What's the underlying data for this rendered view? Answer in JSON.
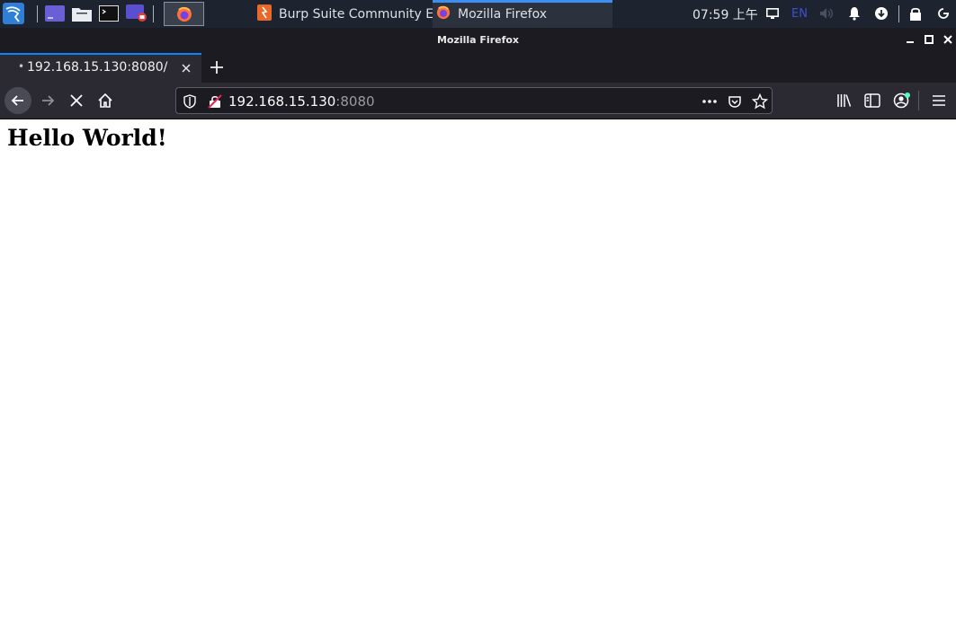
{
  "panel": {
    "tasks": [
      {
        "label": "Burp Suite Community E..."
      },
      {
        "label": "Mozilla Firefox"
      }
    ],
    "clock": "07:59 上午",
    "lang": "EN"
  },
  "window": {
    "title": "Mozilla Firefox"
  },
  "tabs": [
    {
      "label": "192.168.15.130:8080/"
    }
  ],
  "urlbar": {
    "host": "192.168.15.130",
    "port": ":8080"
  },
  "page": {
    "heading": "Hello World!"
  },
  "colors": {
    "accent": "#0a84ff",
    "panel_bg": "#1d232f",
    "toolbar_bg": "#2b2a33"
  }
}
